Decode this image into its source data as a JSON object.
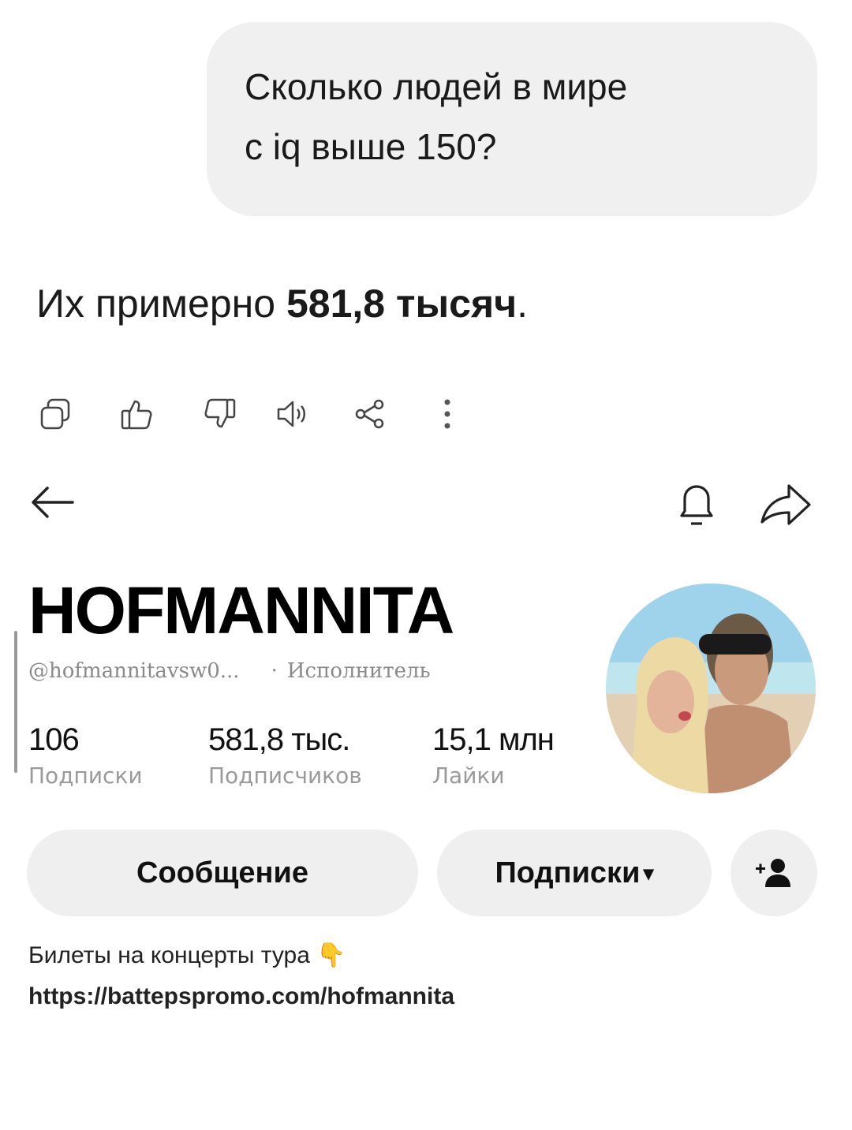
{
  "chat": {
    "question": "Сколько людей в мире\nс iq выше 150?",
    "answer_prefix": "Их примерно ",
    "answer_value": "581,8 тысяч",
    "answer_suffix": "."
  },
  "action_icons": [
    "copy-icon",
    "thumbs-up-icon",
    "thumbs-down-icon",
    "speaker-icon",
    "share-icon",
    "more-vertical-icon"
  ],
  "profile": {
    "name": "HOFMANNITA",
    "handle": "@hofmannitavsw0...",
    "separator": "·",
    "role": "Исполнитель",
    "stats": [
      {
        "value": "106",
        "label": "Подписки"
      },
      {
        "value": "581,8 тыс.",
        "label": "Подписчиков"
      },
      {
        "value": "15,1 млн",
        "label": "Лайки"
      }
    ],
    "buttons": {
      "message": "Сообщение",
      "subscriptions": "Подписки",
      "subscriptions_caret": "▾"
    },
    "bio_line1": "Билеты на концерты тура",
    "bio_emoji": "👇",
    "bio_link": "https://battерspromo.com/hofmannita"
  },
  "colors": {
    "bubble_bg": "#f0f0f0",
    "button_bg": "#efefef",
    "secondary_text": "#9a9a9a"
  }
}
